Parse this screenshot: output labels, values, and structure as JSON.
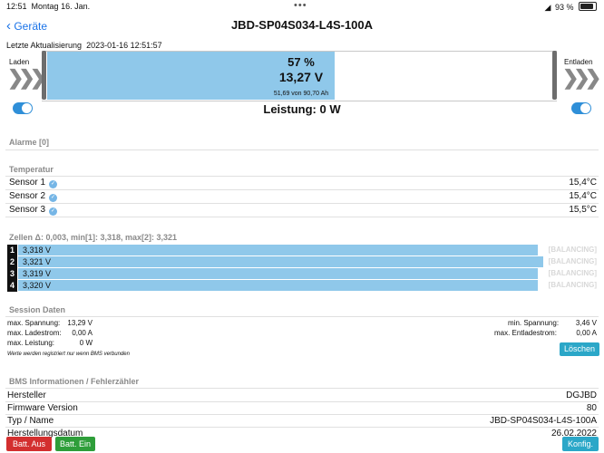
{
  "status_bar": {
    "time": "12:51",
    "date": "Montag 16. Jan.",
    "dots": "•••",
    "battery_pct": "93 %",
    "icons": [
      "wifi-icon",
      "battery-icon"
    ]
  },
  "nav": {
    "back_label": "Geräte",
    "title": "JBD-SP04S034-L4S-100A"
  },
  "last_update": {
    "label": "Letzte Aktualisierung",
    "value": "2023-01-16 12:51:57"
  },
  "charge_label": "Laden",
  "discharge_label": "Entladen",
  "soc": {
    "percent_text": "57 %",
    "fraction": 0.57,
    "voltage": "13,27 V",
    "capacity": "51,69 von 90,70 Ah"
  },
  "power": "Leistung: 0 W",
  "alarms_header": "Alarme [0]",
  "temperature": {
    "header": "Temperatur",
    "sensors": [
      {
        "name": "Sensor 1",
        "value": "15,4°C"
      },
      {
        "name": "Sensor 2",
        "value": "15,4°C"
      },
      {
        "name": "Sensor 3",
        "value": "15,5°C"
      }
    ]
  },
  "cells": {
    "header": "Zellen Δ: 0,003, min[1]: 3,318, max[2]: 3,321",
    "balancing_label": "[BALANCING]",
    "items": [
      {
        "num": "1",
        "voltage": "3,318 V",
        "level": 0.882
      },
      {
        "num": "2",
        "voltage": "3,321 V",
        "level": 0.891
      },
      {
        "num": "3",
        "voltage": "3,319 V",
        "level": 0.882
      },
      {
        "num": "4",
        "voltage": "3,320 V",
        "level": 0.882
      }
    ]
  },
  "session": {
    "header": "Session Daten",
    "max_voltage_label": "max. Spannung:",
    "max_voltage": "13,29 V",
    "max_charge_label": "max. Ladestrom:",
    "max_charge": "0,00 A",
    "max_power_label": "max. Leistung:",
    "max_power": "0 W",
    "min_voltage_label": "min. Spannung:",
    "min_voltage": "3,46 V",
    "max_discharge_label": "max. Entladestrom:",
    "max_discharge": "0,00 A",
    "note": "Werte werden registriert nur wenn BMS verbunden",
    "clear_label": "Löschen"
  },
  "bms_info": {
    "header": "BMS Informationen / Fehlerzähler",
    "rows": [
      {
        "label": "Hersteller",
        "value": "DGJBD"
      },
      {
        "label": "Firmware Version",
        "value": "80"
      },
      {
        "label": "Typ / Name",
        "value": "JBD-SP04S034-L4S-100A"
      },
      {
        "label": "Herstellungsdatum",
        "value": "26.02.2022"
      }
    ]
  },
  "buttons": {
    "batt_off": "Batt. Aus",
    "batt_on": "Batt. Ein",
    "config": "Konfig."
  },
  "colors": {
    "accent": "#1a73e8",
    "soc_fill": "#8fc8ea",
    "toggle": "#2f8fd8",
    "clear_button": "#2ba7c8",
    "batt_off": "#d32f2f",
    "batt_on": "#2e9e3a",
    "config": "#2ba7c8"
  }
}
